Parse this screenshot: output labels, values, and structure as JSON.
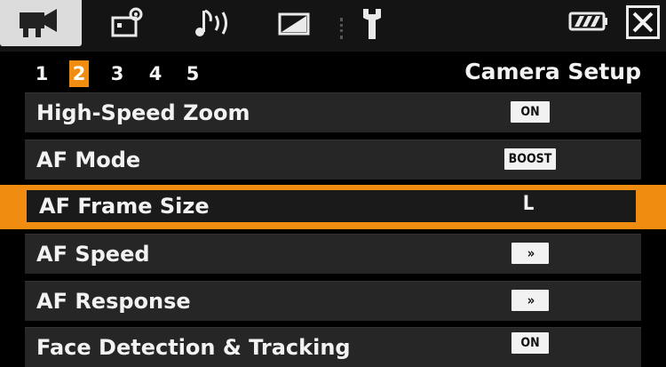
{
  "tabs": [
    {
      "name": "camera-icon",
      "active": true
    },
    {
      "name": "camera-settings-icon",
      "active": false
    },
    {
      "name": "audio-icon",
      "active": false
    },
    {
      "name": "display-icon",
      "active": false
    },
    {
      "name": "wrench-icon",
      "active": false
    }
  ],
  "close_icon": "close-icon",
  "battery_icon": "battery-icon",
  "pager": {
    "pages": [
      "1",
      "2",
      "3",
      "4",
      "5"
    ],
    "active_page": "2",
    "section_title": "Camera Setup"
  },
  "menu": {
    "items": [
      {
        "label": "High-Speed Zoom",
        "value": "ON"
      },
      {
        "label": "AF Mode",
        "value": "BOOST"
      },
      {
        "label": "AF Frame Size",
        "value": "L"
      },
      {
        "label": "AF Speed",
        "value": "»"
      },
      {
        "label": "AF Response",
        "value": "»"
      },
      {
        "label": "Face Detection & Tracking",
        "value": "ON"
      }
    ],
    "selected_index": 2
  },
  "colors": {
    "accent": "#f08c10",
    "row_bg": "#262626",
    "topbar_bg": "#141414"
  }
}
